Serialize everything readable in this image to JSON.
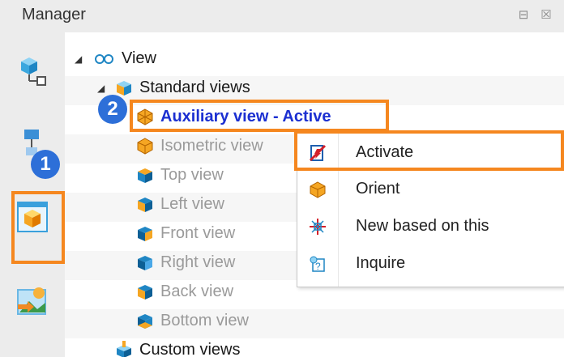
{
  "panel": {
    "title": "Manager",
    "restore_glyph": "⊟",
    "close_glyph": "☒"
  },
  "callouts": {
    "step1": "1",
    "step2": "2"
  },
  "sidebar": {
    "items": [
      {
        "icon": "assembly-tree-icon"
      },
      {
        "icon": "hierarchy-icon"
      },
      {
        "icon": "view-manager-icon",
        "selected": true
      },
      {
        "icon": "image-scene-icon"
      }
    ]
  },
  "tree": {
    "root": {
      "label": "View",
      "icon": "glasses-icon"
    },
    "standard": {
      "label": "Standard views",
      "icon": "standard-views-icon"
    },
    "items": [
      {
        "label": "Auxiliary view - Active",
        "icon": "auxiliary-view-icon"
      },
      {
        "label": "Isometric view",
        "icon": "isometric-view-icon"
      },
      {
        "label": "Top view",
        "icon": "top-view-icon"
      },
      {
        "label": "Left view",
        "icon": "left-view-icon"
      },
      {
        "label": "Front view",
        "icon": "front-view-icon"
      },
      {
        "label": "Right view",
        "icon": "right-view-icon"
      },
      {
        "label": "Back view",
        "icon": "back-view-icon"
      },
      {
        "label": "Bottom view",
        "icon": "bottom-view-icon"
      }
    ],
    "custom": {
      "label": "Custom views",
      "icon": "custom-views-icon"
    }
  },
  "context_menu": {
    "items": [
      {
        "label": "Activate",
        "icon": "activate-icon"
      },
      {
        "label": "Orient",
        "icon": "orient-icon"
      },
      {
        "label": "New based on this",
        "icon": "new-based-icon"
      },
      {
        "label": "Inquire",
        "icon": "inquire-icon"
      }
    ]
  },
  "colors": {
    "highlight": "#f5871f",
    "badge": "#2d6fd8",
    "active_text": "#1b2fd1"
  }
}
